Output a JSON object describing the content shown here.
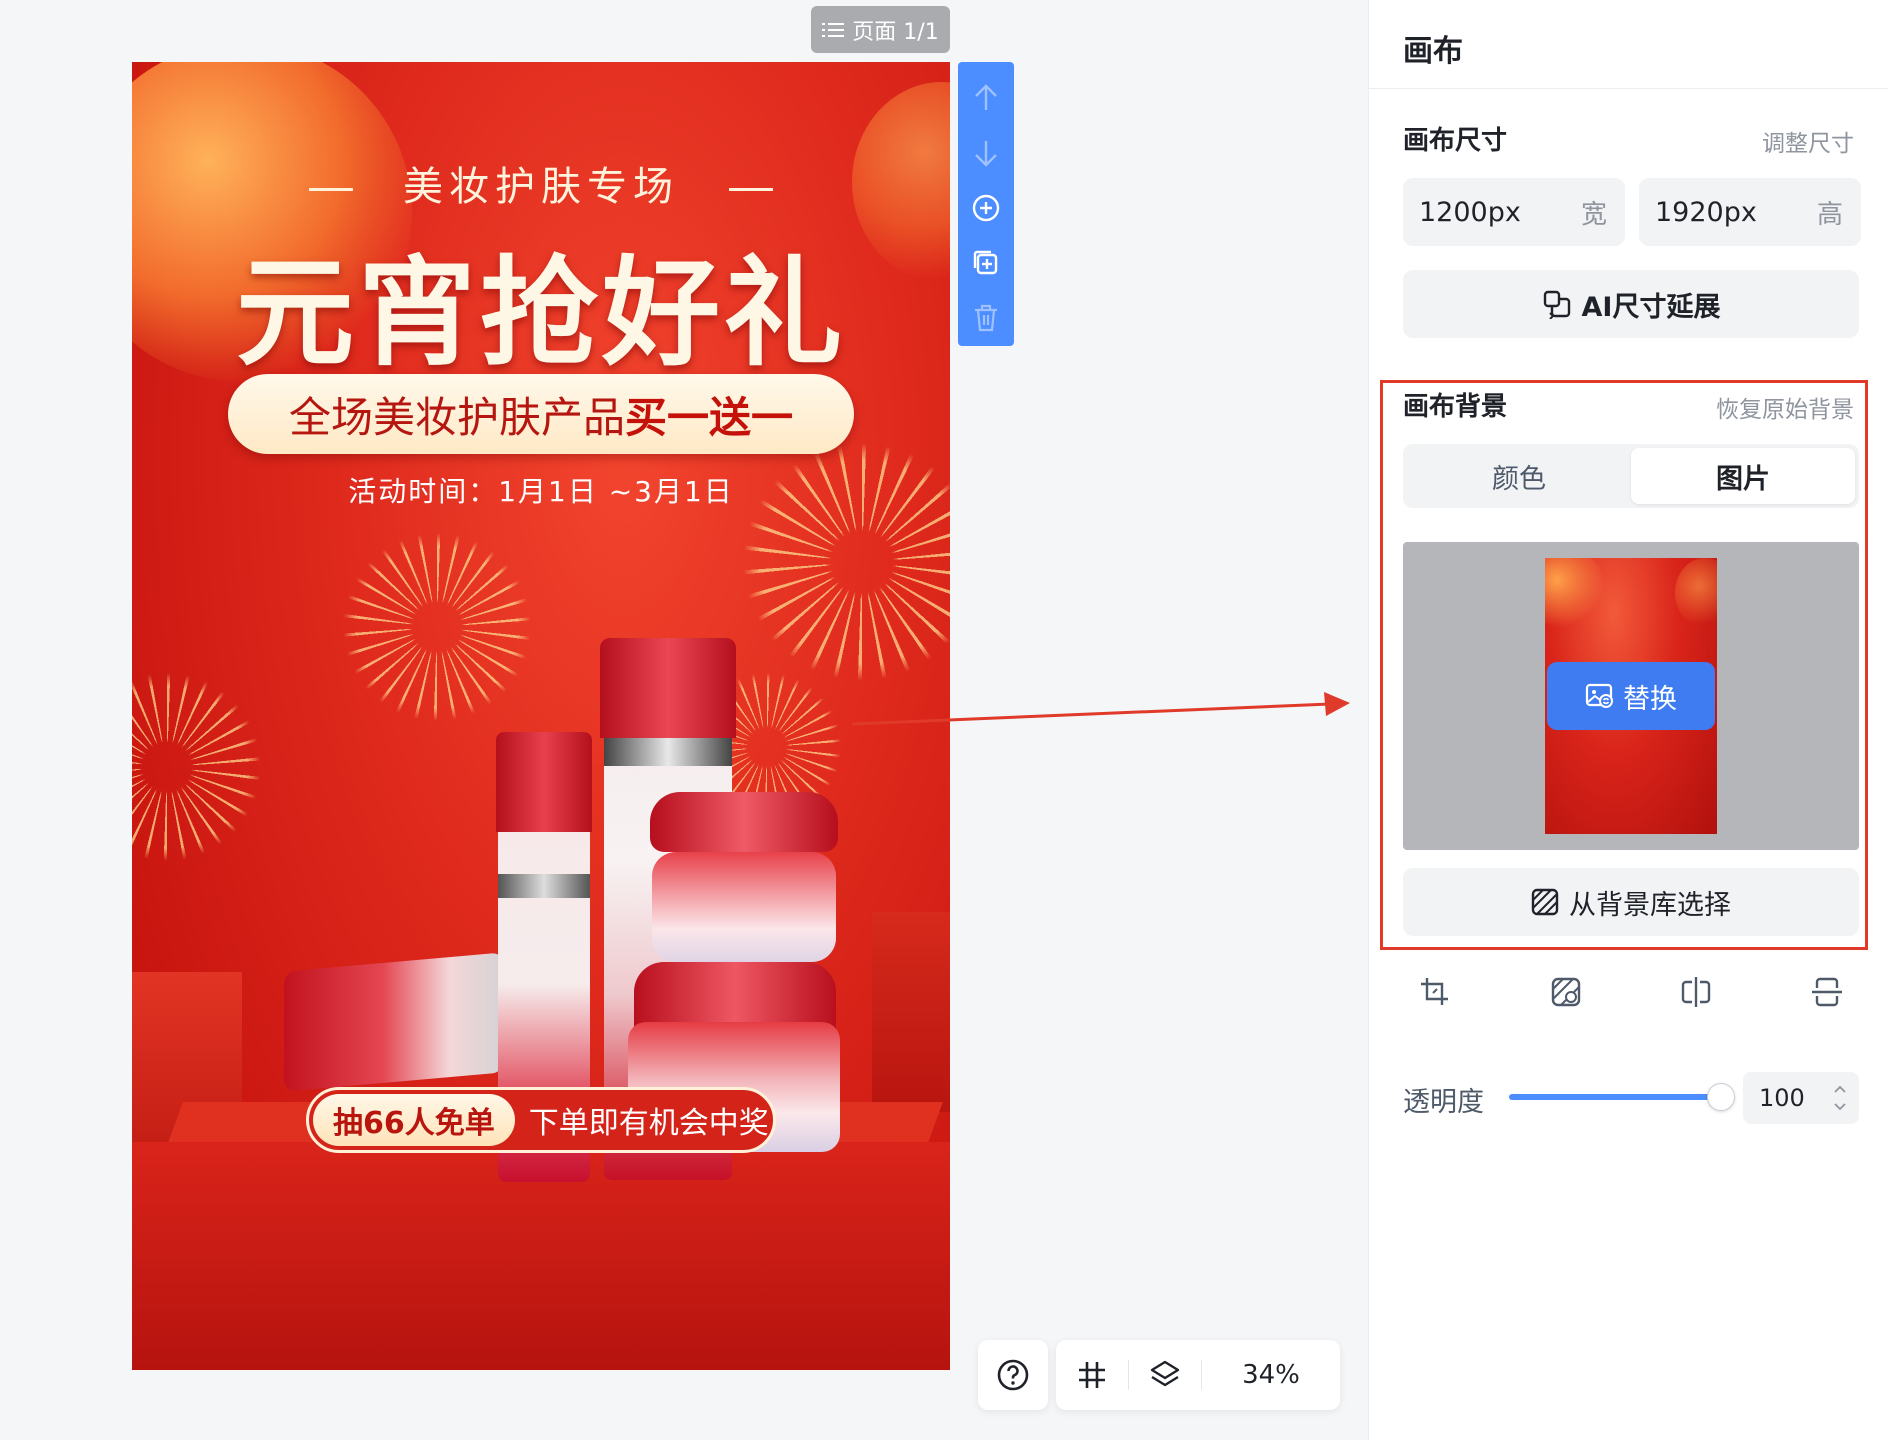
{
  "page_indicator": {
    "label": "页面 1/1",
    "icon": "list-icon"
  },
  "poster": {
    "subtitle": "美妆护肤专场",
    "headline": "元宵抢好礼",
    "promo_prefix": "全场美妆护肤产品",
    "promo_bold": "买一送一",
    "date": "活动时间：1月1日 ~3月1日",
    "lottery_tag": "抽66人免单",
    "lottery_text": "下单即有机会中奖"
  },
  "vertical_toolbar": {
    "icons": [
      "arrow-up-icon",
      "arrow-down-icon",
      "add-page-icon",
      "duplicate-page-icon",
      "delete-page-icon"
    ]
  },
  "bottom_toolbar": {
    "help_icon": "help-icon",
    "grid_icon": "grid-icon",
    "layers_icon": "layers-icon",
    "zoom": "34%"
  },
  "panel": {
    "title": "画布",
    "size_section": {
      "label": "画布尺寸",
      "link": "调整尺寸",
      "width_value": "1200px",
      "width_unit": "宽",
      "height_value": "1920px",
      "height_unit": "高",
      "ai_extend_label": "AI尺寸延展"
    },
    "background_section": {
      "label": "画布背景",
      "link": "恢复原始背景",
      "tabs": [
        {
          "label": "颜色",
          "active": false
        },
        {
          "label": "图片",
          "active": true
        }
      ],
      "replace_label": "替换",
      "library_label": "从背景库选择"
    },
    "image_tools": [
      "crop-icon",
      "matting-icon",
      "flip-horizontal-icon",
      "flip-vertical-icon"
    ],
    "opacity": {
      "label": "透明度",
      "value": "100",
      "level": 1.0
    }
  },
  "colors": {
    "accent": "#4c8dff",
    "replace_button": "#3f7cf2",
    "highlight": "#e03a2a"
  }
}
